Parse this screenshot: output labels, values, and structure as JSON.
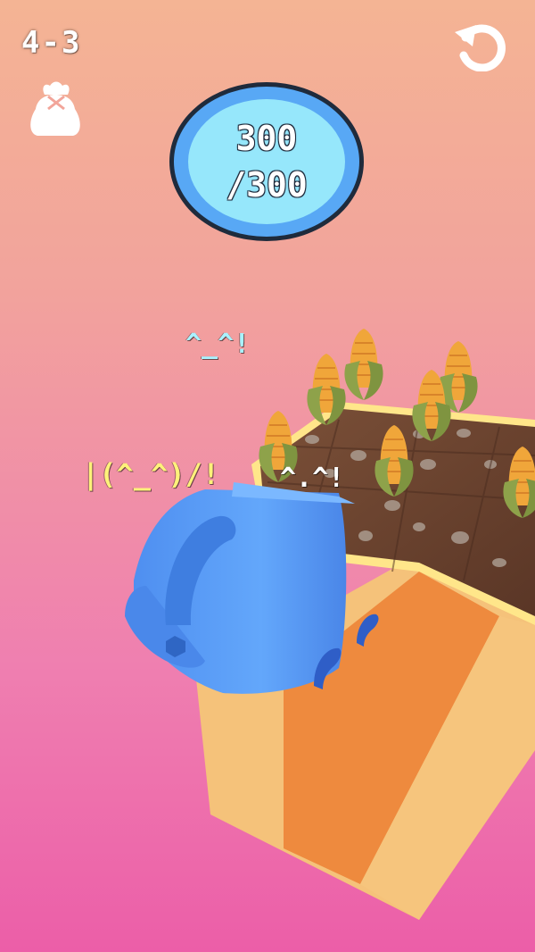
{
  "hud": {
    "level": "4-3",
    "bag_icon": "seed-bag-icon",
    "restart_icon": "restart-icon"
  },
  "score": {
    "current": "300",
    "total": "/300",
    "progress": 1.0
  },
  "emotes": [
    {
      "text": "^_^!",
      "color": "#a9f2ff"
    },
    {
      "text": "|(^_^)/!",
      "color": "#fff27a"
    },
    {
      "text": "^.^!",
      "color": "#ffffff"
    }
  ],
  "scene": {
    "objects": [
      "watering-can",
      "soil-planter-box",
      "corn-crop"
    ],
    "colors": {
      "watering_can": "#5a9cf7",
      "soil": "#6e4632",
      "box_light": "#f5c27a",
      "box_orange": "#ee8a3e",
      "corn": "#f0a63a",
      "husk": "#8ea24a"
    }
  }
}
